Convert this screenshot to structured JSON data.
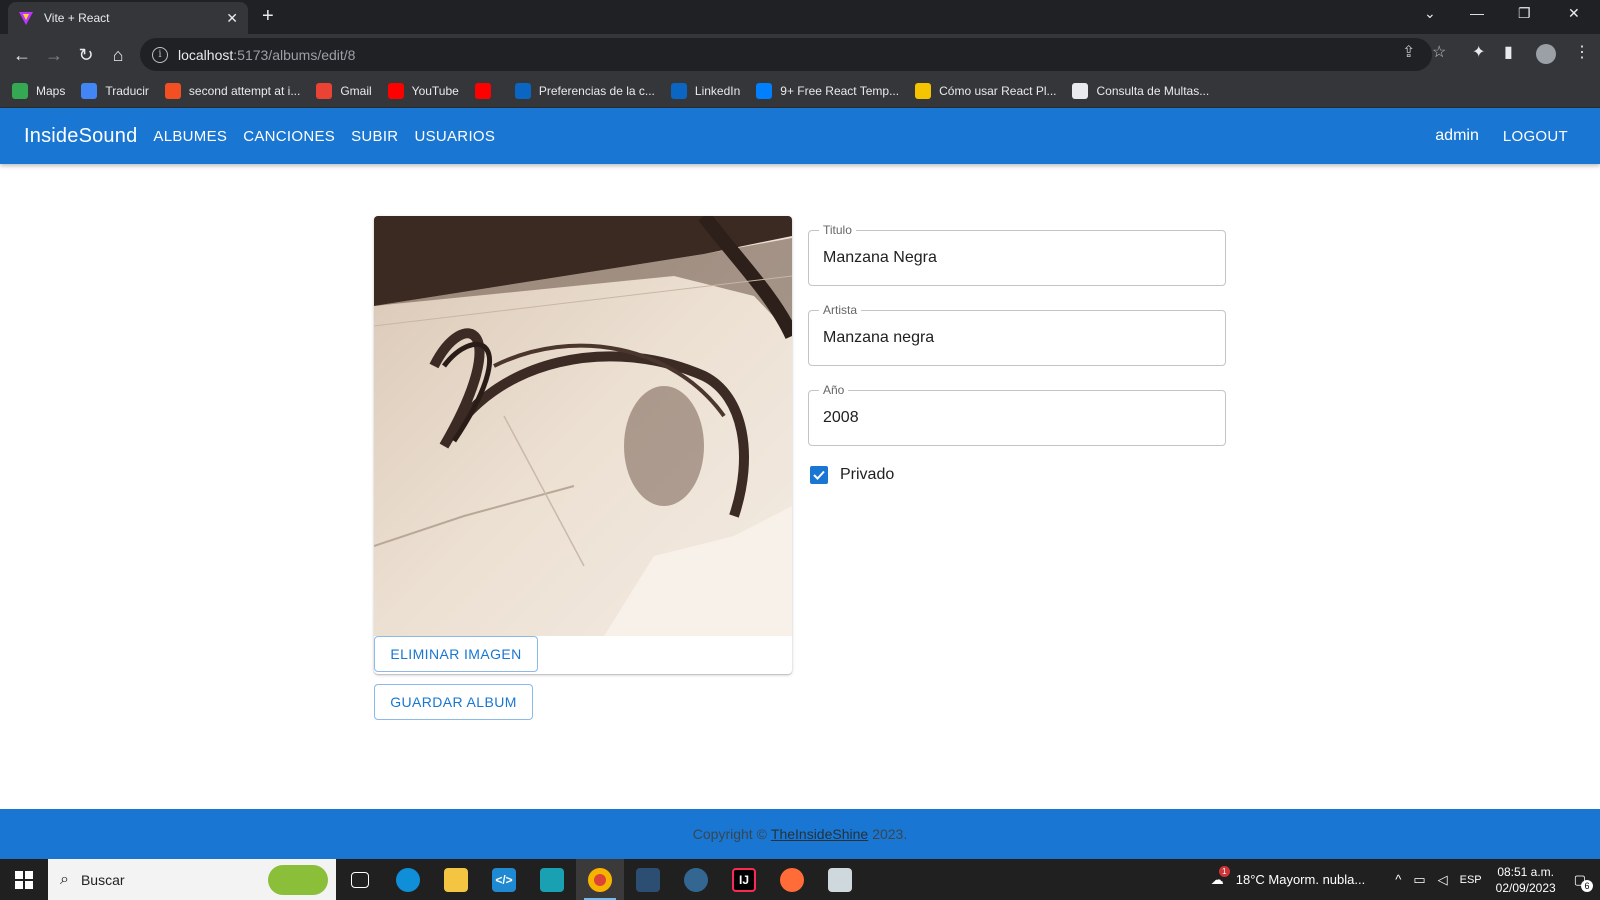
{
  "browser": {
    "tab_title": "Vite + React",
    "tab_close": "✕",
    "new_tab": "+",
    "url_host": "localhost",
    "url_path": ":5173/albums/edit/8",
    "window_controls": {
      "minimize": "—",
      "restore": "❐",
      "close": "✕",
      "tab_search": "⌄"
    },
    "bookmarks": [
      {
        "label": "Maps",
        "icon": "maps-icon",
        "color": "#34a853"
      },
      {
        "label": "Traducir",
        "icon": "translate-icon",
        "color": "#4285f4"
      },
      {
        "label": "second attempt at i...",
        "icon": "microsoft-icon",
        "color": "#f25022"
      },
      {
        "label": "Gmail",
        "icon": "gmail-icon",
        "color": "#ea4335"
      },
      {
        "label": "YouTube",
        "icon": "youtube-icon",
        "color": "#ff0000"
      },
      {
        "label": "",
        "icon": "youtube-music-icon",
        "color": "#ff0000"
      },
      {
        "label": "Preferencias de la c...",
        "icon": "linkedin-icon",
        "color": "#0a66c2"
      },
      {
        "label": "LinkedIn",
        "icon": "linkedin-icon",
        "color": "#0a66c2"
      },
      {
        "label": "9+ Free React Temp...",
        "icon": "mui-icon",
        "color": "#007fff"
      },
      {
        "label": "Cómo usar React Pl...",
        "icon": "batman-icon",
        "color": "#f5c400"
      },
      {
        "label": "Consulta de Multas...",
        "icon": "document-icon",
        "color": "#e8eaed"
      }
    ]
  },
  "app": {
    "brand": "InsideSound",
    "nav": [
      "ALBUMES",
      "CANCIONES",
      "SUBIR",
      "USUARIOS"
    ],
    "user": "admin",
    "logout": "LOGOUT",
    "accent": "#1976d2"
  },
  "form": {
    "delete_image": "ELIMINAR IMAGEN",
    "save": "GUARDAR ALBUM",
    "title_label": "Titulo",
    "title_value": "Manzana Negra",
    "artist_label": "Artista",
    "artist_value": "Manzana negra",
    "year_label": "Año",
    "year_value": "2008",
    "private_label": "Privado",
    "private_checked": true
  },
  "footer": {
    "prefix": "Copyright ©",
    "link": "TheInsideShine",
    "suffix": "2023."
  },
  "taskbar": {
    "search_placeholder": "Buscar",
    "weather": "18°C  Mayorm. nubla...",
    "weather_badge": "1",
    "lang": "ESP",
    "time": "08:51 a.m.",
    "date": "02/09/2023",
    "notifications": "6"
  }
}
